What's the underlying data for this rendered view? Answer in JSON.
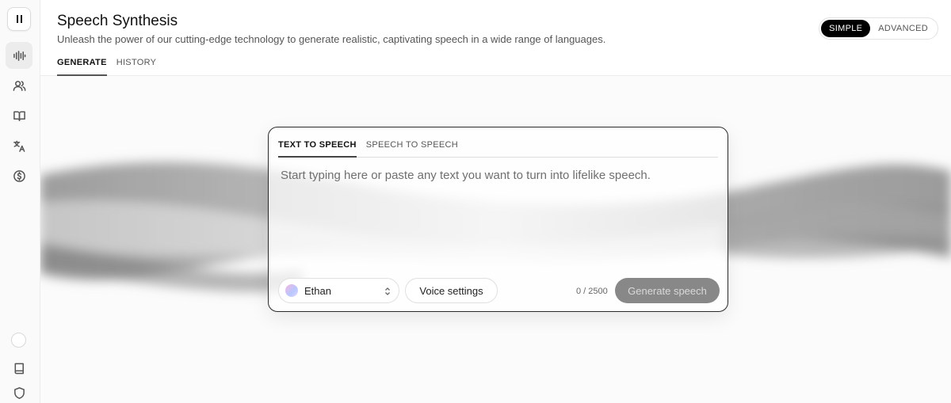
{
  "header": {
    "title": "Speech Synthesis",
    "subtitle": "Unleash the power of our cutting-edge technology to generate realistic, captivating speech in a wide range of languages.",
    "tabs": [
      {
        "label": "GENERATE",
        "active": true
      },
      {
        "label": "HISTORY",
        "active": false
      }
    ],
    "mode_toggle": [
      {
        "label": "SIMPLE",
        "active": true
      },
      {
        "label": "ADVANCED",
        "active": false
      }
    ]
  },
  "sidebar": {
    "items": [
      {
        "icon": "waveform-icon",
        "active": true
      },
      {
        "icon": "users-icon",
        "active": false
      },
      {
        "icon": "book-open-icon",
        "active": false
      },
      {
        "icon": "translate-icon",
        "active": false
      },
      {
        "icon": "dollar-icon",
        "active": false
      }
    ],
    "bottom_items": [
      {
        "icon": "avatar-icon"
      },
      {
        "icon": "docs-icon"
      },
      {
        "icon": "shield-icon"
      }
    ]
  },
  "card": {
    "tabs": [
      {
        "label": "TEXT TO SPEECH",
        "active": true
      },
      {
        "label": "SPEECH TO SPEECH",
        "active": false
      }
    ],
    "placeholder": "Start typing here or paste any text you want to turn into lifelike speech.",
    "voice": "Ethan",
    "voice_settings_label": "Voice settings",
    "char_count": "0 / 2500",
    "generate_label": "Generate speech"
  },
  "colors": {
    "accent": "#000000",
    "generate_disabled": "#888888",
    "card_border": "#2a2a2a"
  }
}
